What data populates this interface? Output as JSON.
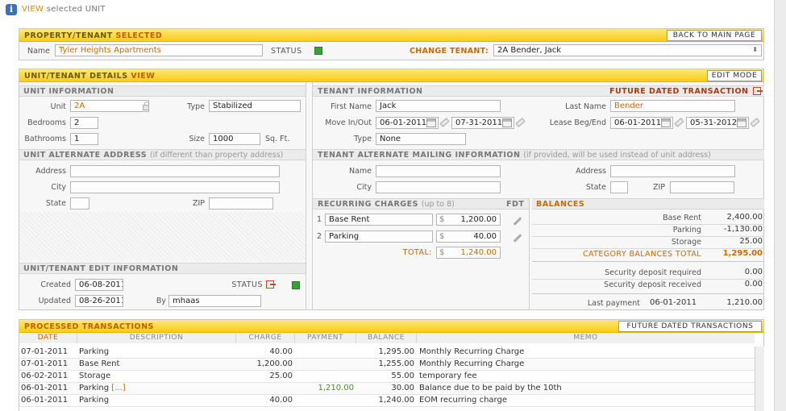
{
  "page": {
    "view_kw": "VIEW",
    "view_rest": "selected UNIT"
  },
  "property_panel": {
    "title_main": "PROPERTY/TENANT",
    "title_kw": "SELECTED",
    "back_button": "BACK TO MAIN PAGE",
    "name_label": "Name",
    "name_value": "Tyler Heights Apartments",
    "status_label": "STATUS",
    "status_color": "#3aa03a",
    "change_tenant_label": "CHANGE TENANT:",
    "change_tenant_value": "2A Bender, Jack"
  },
  "details_panel": {
    "title_main": "UNIT/TENANT DETAILS",
    "title_kw": "VIEW",
    "edit_button": "EDIT MODE",
    "unit_info": {
      "header": "UNIT INFORMATION",
      "unit_label": "Unit",
      "unit_value": "2A",
      "type_label": "Type",
      "type_value": "Stabilized",
      "bedrooms_label": "Bedrooms",
      "bedrooms_value": "2",
      "bathrooms_label": "Bathrooms",
      "bathrooms_value": "1",
      "size_label": "Size",
      "size_value": "1000",
      "size_unit": "Sq. Ft."
    },
    "unit_alt": {
      "header": "UNIT ALTERNATE ADDRESS",
      "note": "(if different than property address)",
      "address_label": "Address",
      "city_label": "City",
      "state_label": "State",
      "zip_label": "ZIP"
    },
    "edit_info": {
      "header": "UNIT/TENANT EDIT INFORMATION",
      "created_label": "Created",
      "created_value": "06-08-2011",
      "updated_label": "Updated",
      "updated_value": "08-26-2011",
      "status_label": "STATUS",
      "by_label": "By",
      "by_value": "mhaas"
    },
    "tenant_info": {
      "header": "TENANT INFORMATION",
      "future_link": "FUTURE DATED TRANSACTION",
      "first_label": "First Name",
      "first_value": "Jack",
      "last_label": "Last Name",
      "last_value": "Bender",
      "movein_label": "Move In/Out",
      "movein_value": "06-01-2011",
      "moveout_value": "07-31-2011",
      "lease_label": "Lease Beg/End",
      "lease_beg": "06-01-2011",
      "lease_end": "05-31-2012",
      "type_label": "Type",
      "type_value": "None"
    },
    "tenant_alt": {
      "header": "TENANT ALTERNATE MAILING INFORMATION",
      "note": "(if provided, will be used instead of unit address)",
      "name_label": "Name",
      "city_label": "City",
      "address_label": "Address",
      "state_label": "State",
      "zip_label": "ZIP"
    },
    "recurring": {
      "header": "RECURRING CHARGES",
      "note": "(up to 8)",
      "fdt_label": "FDT",
      "rows": [
        {
          "num": "1",
          "name": "Base Rent",
          "cur": "$",
          "amount": "1,200.00"
        },
        {
          "num": "2",
          "name": "Parking",
          "cur": "$",
          "amount": "40.00"
        }
      ],
      "total_label": "TOTAL:",
      "total_cur": "$",
      "total_value": "1,240.00"
    },
    "balances": {
      "header": "BALANCES",
      "rows": [
        {
          "label": "Base Rent",
          "value": "2,400.00"
        },
        {
          "label": "Parking",
          "value": "-1,130.00"
        },
        {
          "label": "Storage",
          "value": "25.00"
        }
      ],
      "category_label": "CATEGORY BALANCES TOTAL",
      "category_value": "1,295.00",
      "deposit_required_label": "Security deposit required",
      "deposit_required_value": "0.00",
      "deposit_received_label": "Security deposit received",
      "deposit_received_value": "0.00",
      "last_payment_label": "Last payment",
      "last_payment_date": "06-01-2011",
      "last_payment_value": "1,210.00"
    }
  },
  "transactions": {
    "title": "PROCESSED TRANSACTIONS",
    "future_button": "FUTURE DATED TRANSACTIONS",
    "columns": [
      "DATE",
      "DESCRIPTION",
      "CHARGE",
      "PAYMENT",
      "BALANCE",
      "MEMO"
    ],
    "rows": [
      {
        "date": "07-01-2011",
        "desc": "Parking",
        "more": "",
        "charge": "40.00",
        "payment": "",
        "balance": "1,295.00",
        "memo": "Monthly Recurring Charge"
      },
      {
        "date": "07-01-2011",
        "desc": "Base Rent",
        "more": "",
        "charge": "1,200.00",
        "payment": "",
        "balance": "1,255.00",
        "memo": "Monthly Recurring Charge"
      },
      {
        "date": "06-02-2011",
        "desc": "Storage",
        "more": "",
        "charge": "25.00",
        "payment": "",
        "balance": "55.00",
        "memo": "temporary fee"
      },
      {
        "date": "06-01-2011",
        "desc": "Parking",
        "more": "[...]",
        "charge": "",
        "payment": "1,210.00",
        "balance": "30.00",
        "memo": "Balance due to be paid by the 10th"
      },
      {
        "date": "06-01-2011",
        "desc": "Parking",
        "more": "",
        "charge": "40.00",
        "payment": "",
        "balance": "1,240.00",
        "memo": "EOM recurring charge"
      }
    ]
  }
}
